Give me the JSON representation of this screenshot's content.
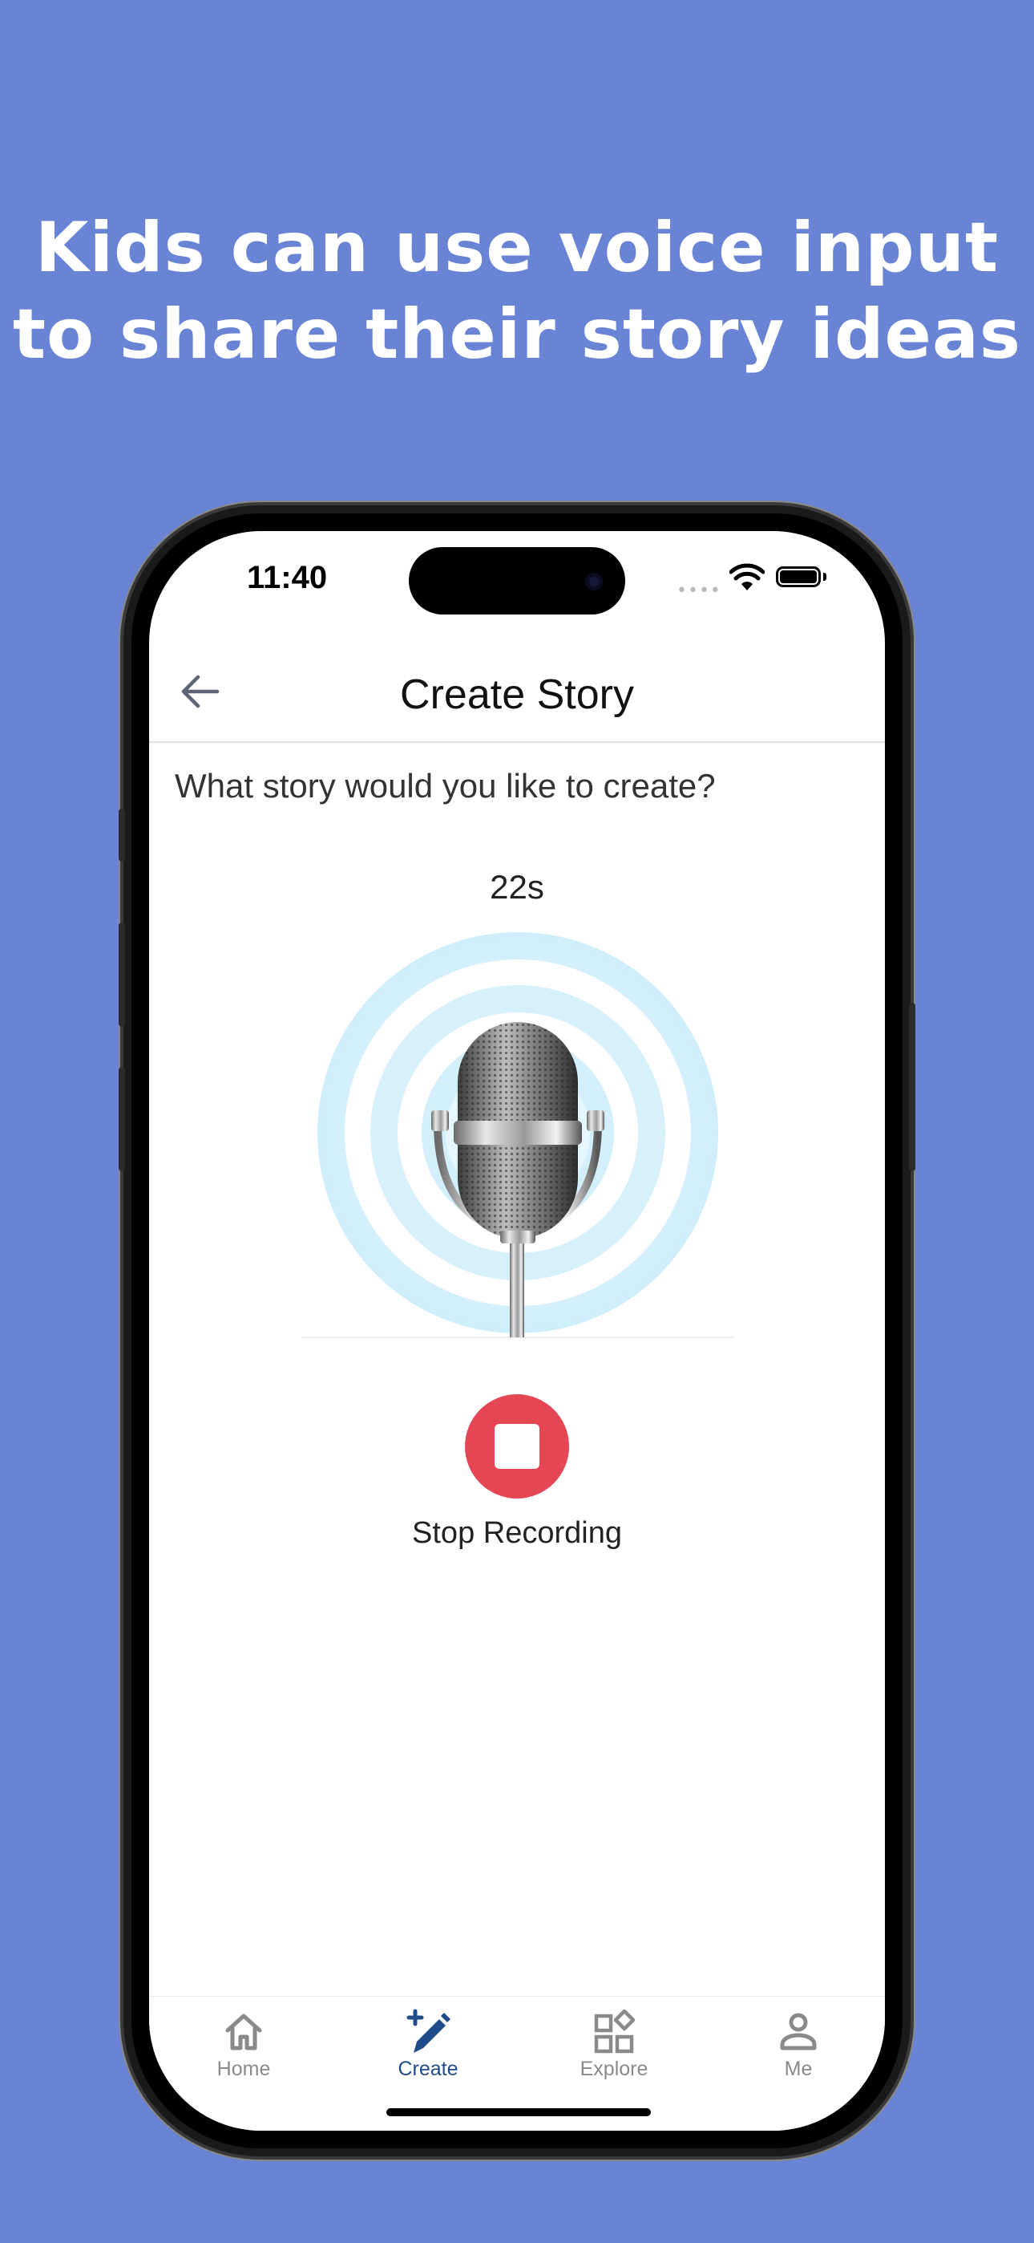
{
  "marketing": {
    "headline_line1": "Kids can use voice input",
    "headline_line2": "to share their story ideas"
  },
  "status_bar": {
    "time": "11:40",
    "icons": [
      "cellular-signal-icon",
      "wifi-icon",
      "battery-icon"
    ]
  },
  "header": {
    "back_icon": "arrow-left-icon",
    "title": "Create Story"
  },
  "main": {
    "prompt": "What story would you like to create?",
    "timer": "22s",
    "mic_icon": "microphone-icon",
    "stop_icon": "stop-square-icon",
    "stop_label": "Stop Recording"
  },
  "tab_bar": {
    "active": "Create",
    "items": [
      {
        "label": "Home",
        "icon": "home-icon"
      },
      {
        "label": "Create",
        "icon": "pencil-plus-icon"
      },
      {
        "label": "Explore",
        "icon": "apps-icon"
      },
      {
        "label": "Me",
        "icon": "person-icon"
      }
    ]
  },
  "colors": {
    "background": "#6a84d5",
    "stop_button": "#e54653",
    "active_tab": "#1f4d8c",
    "inactive_tab": "#8a8a8a",
    "ripple": "#d9f1fd"
  }
}
